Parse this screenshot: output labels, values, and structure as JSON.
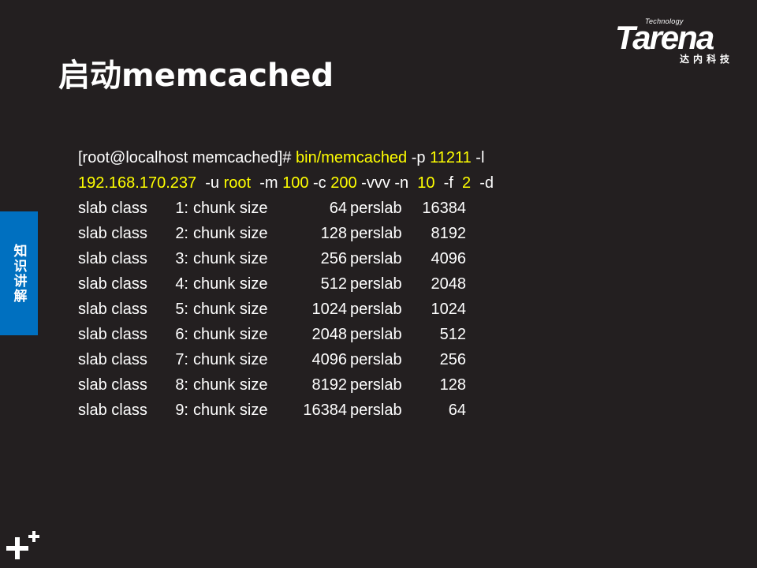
{
  "slide": {
    "title": "启动memcached"
  },
  "logo": {
    "small_text": "Technology",
    "word": "Tarena",
    "chinese": "达内科技"
  },
  "side_tab": {
    "label": "知识讲解"
  },
  "command": {
    "line1_prompt": "[root@localhost memcached]# ",
    "line1_bin": "bin/memcached",
    "line1_p_flag": " -p ",
    "line1_port": "11211",
    "line1_l_flag": " -l",
    "line2_ip": "192.168.170.237",
    "line2_u_flag": "  -u ",
    "line2_user": "root",
    "line2_m_flag": "  -m ",
    "line2_mem": "100",
    "line2_c_flag": " -c ",
    "line2_conn": "200",
    "line2_v_n_flags": " -vvv -n  ",
    "line2_n_val": "10",
    "line2_f_flag": "  -f  ",
    "line2_f_val": "2",
    "line2_d_flag": "  -d"
  },
  "slab_rows": [
    {
      "label": "slab class",
      "idx": "1:",
      "chunk": "chunk size",
      "size": "64",
      "per": "perslab",
      "count": "16384"
    },
    {
      "label": "slab class",
      "idx": "2:",
      "chunk": "chunk size",
      "size": "128",
      "per": "perslab",
      "count": "8192"
    },
    {
      "label": "slab class",
      "idx": "3:",
      "chunk": "chunk size",
      "size": "256",
      "per": "perslab",
      "count": "4096"
    },
    {
      "label": "slab class",
      "idx": "4:",
      "chunk": "chunk size",
      "size": "512",
      "per": "perslab",
      "count": "2048"
    },
    {
      "label": "slab class",
      "idx": "5:",
      "chunk": "chunk size",
      "size": "1024",
      "per": "perslab",
      "count": "1024"
    },
    {
      "label": "slab class",
      "idx": "6:",
      "chunk": "chunk size",
      "size": "2048",
      "per": "perslab",
      "count": "512"
    },
    {
      "label": "slab class",
      "idx": "7:",
      "chunk": "chunk size",
      "size": "4096",
      "per": "perslab",
      "count": "256"
    },
    {
      "label": "slab class",
      "idx": "8:",
      "chunk": "chunk size",
      "size": "8192",
      "per": "perslab",
      "count": "128"
    },
    {
      "label": "slab class",
      "idx": "9:",
      "chunk": "chunk size",
      "size": "16384",
      "per": "perslab",
      "count": "64"
    }
  ],
  "colors": {
    "background": "#231f20",
    "highlight": "#ffff00",
    "side_tab": "#0070c0"
  },
  "icons": {
    "corner": "plus-plus-icon"
  }
}
